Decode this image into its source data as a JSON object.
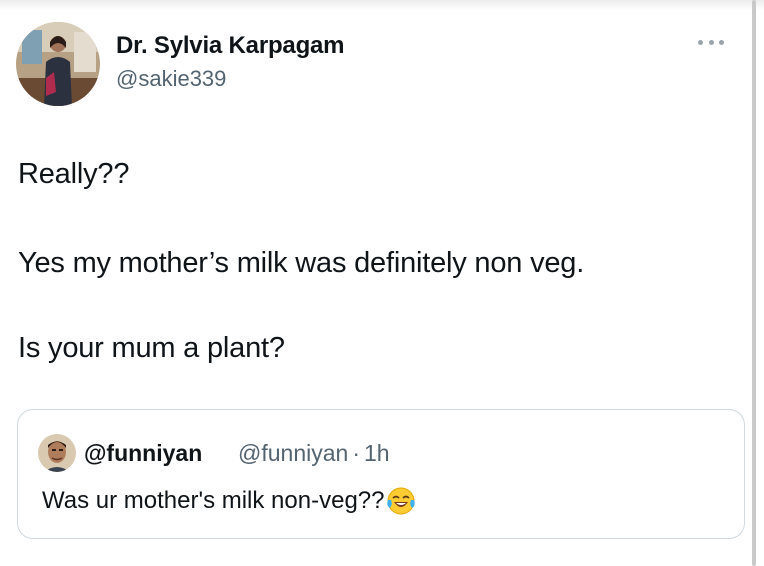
{
  "tweet": {
    "author_name": "Dr. Sylvia Karpagam",
    "author_handle": "@sakie339",
    "lines": [
      "Really??",
      "Yes my mother’s milk was definitely non veg.",
      "Is your mum a plant?"
    ]
  },
  "quoted_tweet": {
    "author_name": "@funniyan",
    "author_handle": "@funniyan",
    "separator": "·",
    "time": "1h",
    "text": "Was ur mother's milk non-veg??",
    "emoji": "face-with-tears-of-joy-icon"
  },
  "icons": {
    "more": "more-options-icon"
  },
  "colors": {
    "text": "#0f1419",
    "secondary": "#536471",
    "border": "#cfd9de"
  }
}
